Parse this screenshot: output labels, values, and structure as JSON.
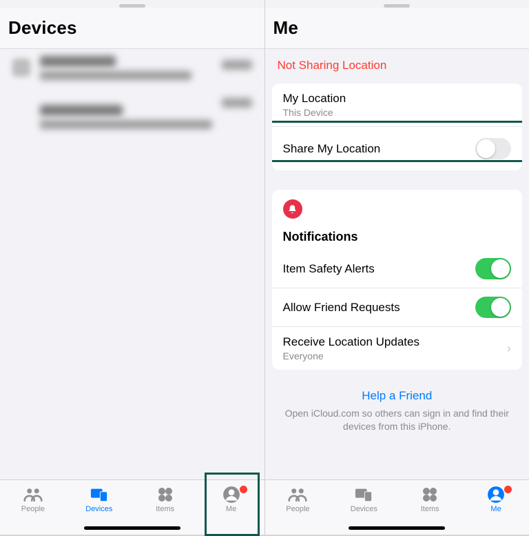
{
  "left": {
    "title": "Devices",
    "tabs": {
      "people": "People",
      "devices": "Devices",
      "items": "Items",
      "me": "Me"
    }
  },
  "right": {
    "title": "Me",
    "status": "Not Sharing Location",
    "location": {
      "title": "My Location",
      "sub": "This Device"
    },
    "share": {
      "label": "Share My Location",
      "on": false
    },
    "notifications": {
      "heading": "Notifications",
      "item_safety": {
        "label": "Item Safety Alerts",
        "on": true
      },
      "friend_req": {
        "label": "Allow Friend Requests",
        "on": true
      },
      "receive": {
        "label": "Receive Location Updates",
        "sub": "Everyone"
      }
    },
    "help": {
      "link": "Help a Friend",
      "sub": "Open iCloud.com so others can sign in and find their devices from this iPhone."
    },
    "tabs": {
      "people": "People",
      "devices": "Devices",
      "items": "Items",
      "me": "Me"
    }
  }
}
